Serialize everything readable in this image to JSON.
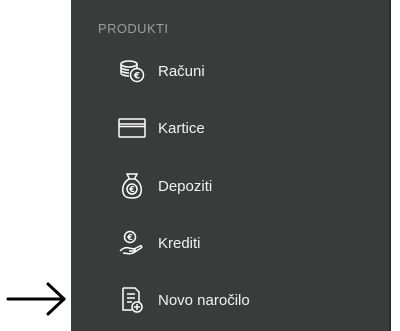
{
  "section": {
    "title": "PRODUKTI"
  },
  "menu": {
    "items": [
      {
        "label": "Računi",
        "icon": "coins-euro-icon"
      },
      {
        "label": "Kartice",
        "icon": "card-icon"
      },
      {
        "label": "Depoziti",
        "icon": "money-bag-euro-icon"
      },
      {
        "label": "Krediti",
        "icon": "hand-euro-coin-icon"
      },
      {
        "label": "Novo naročilo",
        "icon": "new-order-document-icon"
      }
    ]
  },
  "annotation": {
    "icon": "right-arrow-icon",
    "points_to": "Novo naročilo"
  },
  "colors": {
    "panel_background": "#3a3c3b",
    "header_text": "#9c9e9d",
    "item_text": "#f2f2f2",
    "icon_stroke": "#ffffff",
    "page_background": "#ffffff",
    "arrow": "#000000"
  }
}
